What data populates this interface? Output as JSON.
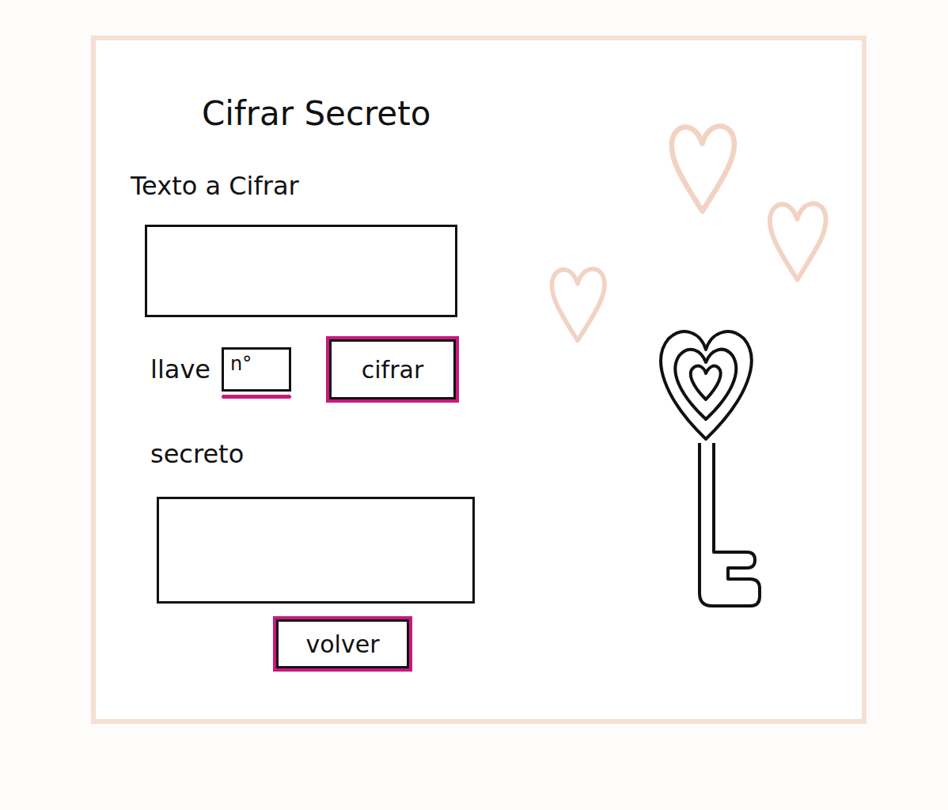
{
  "window": {
    "title": "Cifrar Secreto"
  },
  "input": {
    "label": "Texto a Cifrar"
  },
  "key": {
    "label": "llave",
    "placeholder": "n°"
  },
  "output": {
    "label": "secreto"
  },
  "buttons": {
    "encrypt": "cifrar",
    "back": "volver"
  }
}
